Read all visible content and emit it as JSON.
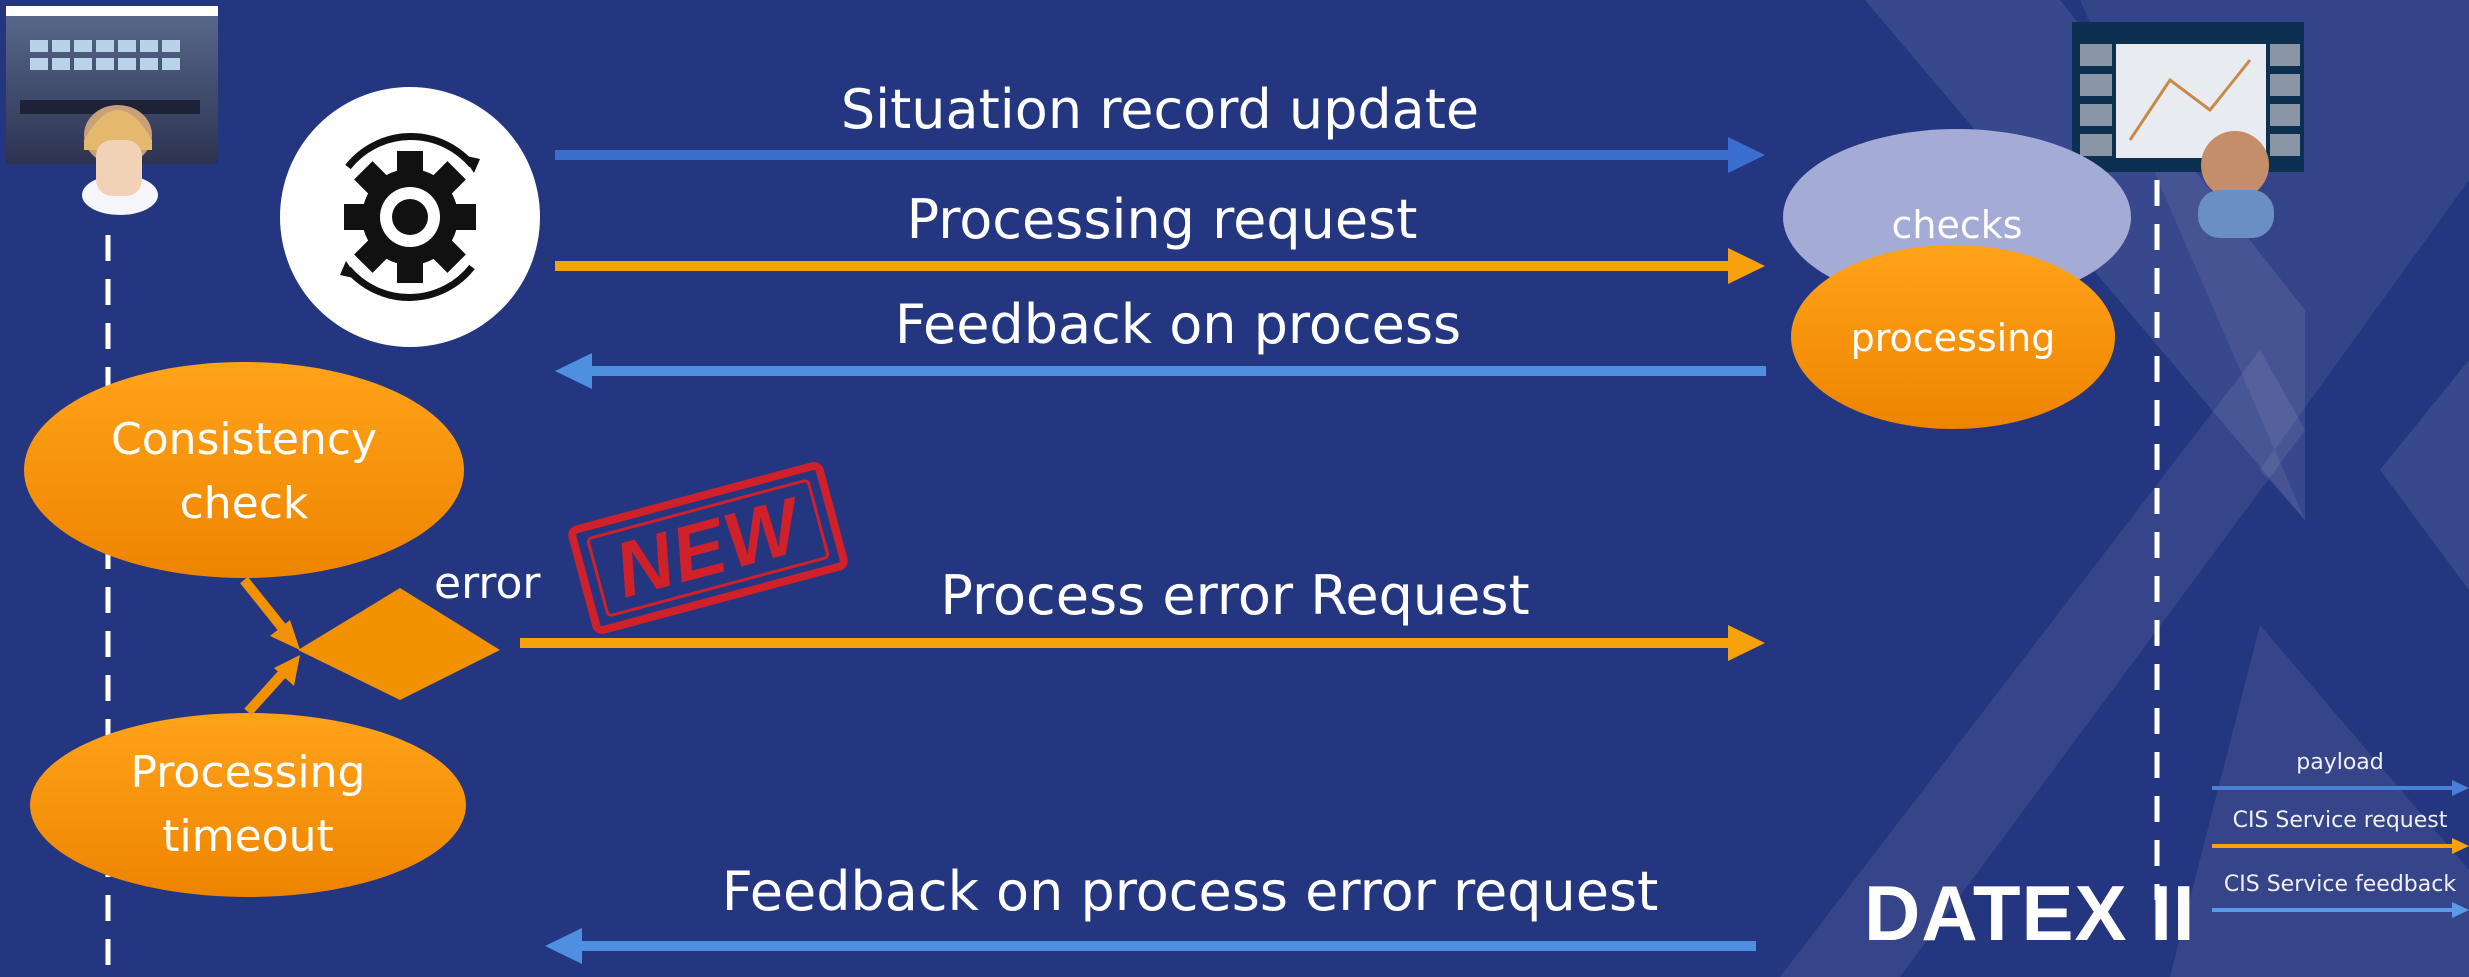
{
  "colors": {
    "background": "#253681",
    "payload_arrow": "#3a6fd0",
    "request_arrow": "#f7a20a",
    "feedback_arrow": "#4f8fe0",
    "node_orange": "#f39200",
    "node_lavender": "#a4acd6"
  },
  "arrows": {
    "situation_record_update": "Situation record update",
    "processing_request": "Processing request",
    "feedback_on_process": "Feedback on process",
    "process_error_request": "Process error Request",
    "feedback_on_process_error_request": "Feedback on process error request"
  },
  "nodes": {
    "consistency_check": "Consistency check",
    "processing_timeout": "Processing timeout",
    "error": "error",
    "checks": "checks",
    "processing": "processing"
  },
  "stamp": "NEW",
  "logo": "DATEX II",
  "legend": [
    {
      "label": "payload",
      "color": "#4a7fd5"
    },
    {
      "label": "CIS Service request",
      "color": "#f7a20a"
    },
    {
      "label": "CIS Service feedback",
      "color": "#5a9ae6"
    }
  ],
  "icons": [
    "operator-left-icon",
    "operator-right-icon",
    "process-gear-icon"
  ]
}
